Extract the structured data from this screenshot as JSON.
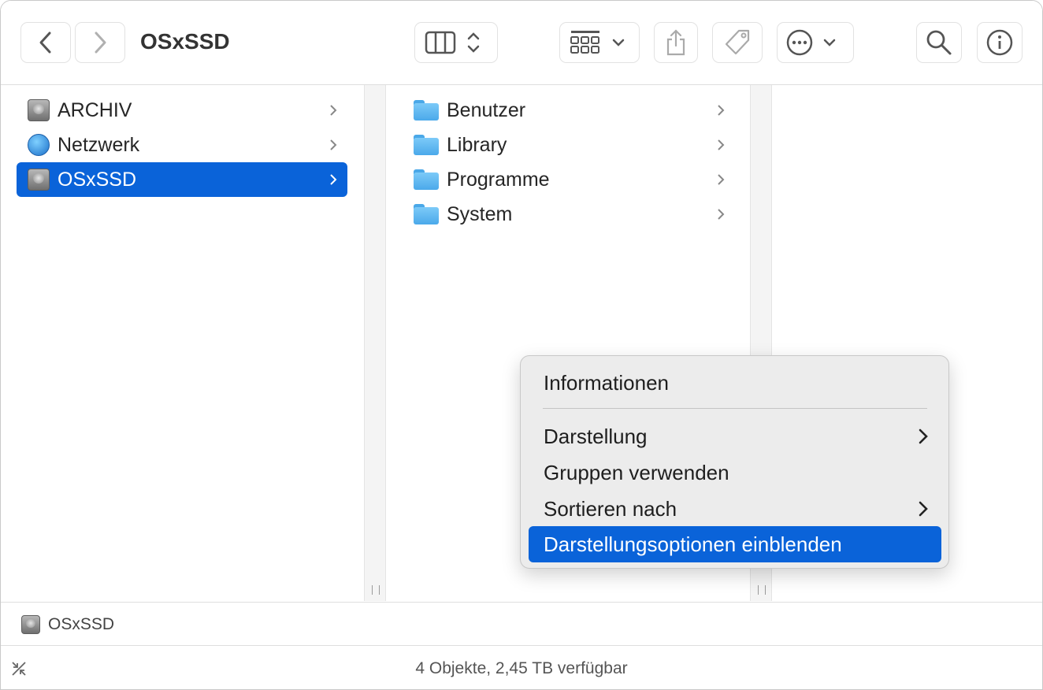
{
  "window": {
    "title": "OSxSSD"
  },
  "toolbar": {
    "back_icon": "chevron-left-icon",
    "forward_icon": "chevron-right-icon",
    "view_icon": "column-view-icon",
    "group_icon": "grid-group-icon",
    "share_icon": "share-icon",
    "tag_icon": "tag-icon",
    "action_icon": "ellipsis-circle-icon",
    "search_icon": "search-icon",
    "info_icon": "info-icon"
  },
  "sidebar": {
    "items": [
      {
        "label": "ARCHIV",
        "icon": "disk-icon",
        "selected": false
      },
      {
        "label": "Netzwerk",
        "icon": "globe-icon",
        "selected": false
      },
      {
        "label": "OSxSSD",
        "icon": "disk-icon",
        "selected": true
      }
    ]
  },
  "column2": {
    "items": [
      {
        "label": "Benutzer",
        "icon": "folder-users-icon"
      },
      {
        "label": "Library",
        "icon": "folder-library-icon"
      },
      {
        "label": "Programme",
        "icon": "folder-apps-icon"
      },
      {
        "label": "System",
        "icon": "folder-macos-icon"
      }
    ]
  },
  "context_menu": {
    "items": [
      {
        "label": "Informationen",
        "submenu": false
      },
      {
        "label": "Darstellung",
        "submenu": true
      },
      {
        "label": "Gruppen verwenden",
        "submenu": false
      },
      {
        "label": "Sortieren nach",
        "submenu": true
      },
      {
        "label": "Darstellungsoptionen einblenden",
        "submenu": false,
        "highlighted": true
      }
    ]
  },
  "pathbar": {
    "label": "OSxSSD"
  },
  "statusbar": {
    "text": "4 Objekte, 2,45 TB verfügbar"
  },
  "colors": {
    "accent": "#0a63d9",
    "folder": "#5db4ef"
  }
}
